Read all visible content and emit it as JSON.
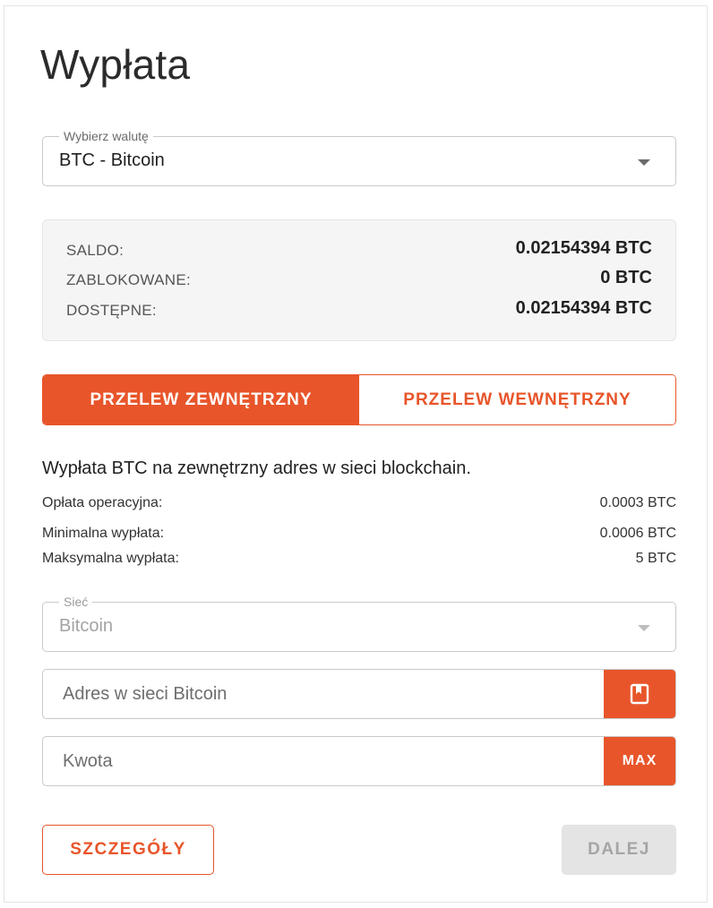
{
  "page": {
    "title": "Wypłata"
  },
  "currency_select": {
    "label": "Wybierz walutę",
    "value": "BTC - Bitcoin"
  },
  "balance": {
    "rows": [
      {
        "label": "SALDO:",
        "value": "0.02154394 BTC"
      },
      {
        "label": "ZABLOKOWANE:",
        "value": "0 BTC"
      },
      {
        "label": "DOSTĘPNE:",
        "value": "0.02154394 BTC"
      }
    ]
  },
  "tabs": [
    {
      "label": "PRZELEW ZEWNĘTRZNY",
      "active": true
    },
    {
      "label": "PRZELEW WEWNĘTRZNY",
      "active": false
    }
  ],
  "transfer_info": {
    "description": "Wypłata BTC na zewnętrzny adres w sieci blockchain.",
    "rows": [
      {
        "label": "Opłata operacyjna:",
        "value": "0.0003 BTC"
      },
      {
        "label": "Minimalna wypłata:",
        "value": "0.0006 BTC"
      },
      {
        "label": "Maksymalna wypłata:",
        "value": "5 BTC"
      }
    ]
  },
  "network_select": {
    "label": "Sieć",
    "value": "Bitcoin",
    "disabled": true
  },
  "address_input": {
    "placeholder": "Adres w sieci Bitcoin",
    "value": "",
    "addon_icon": "address-book-icon"
  },
  "amount_input": {
    "placeholder": "Kwota",
    "value": "",
    "addon_label": "MAX"
  },
  "actions": {
    "details_label": "SZCZEGÓŁY",
    "next_label": "DALEJ",
    "next_disabled": true
  },
  "colors": {
    "accent": "#e8552a",
    "disabled_bg": "#e4e4e4",
    "panel_bg": "#f5f5f5"
  }
}
